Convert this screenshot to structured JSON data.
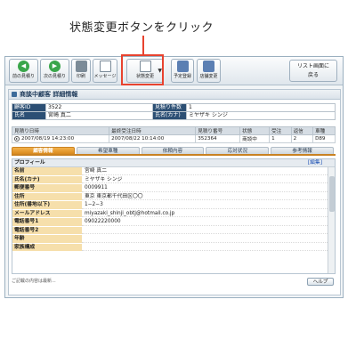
{
  "caption": "状態変更ボタンをクリック",
  "toolbar": {
    "buttons": [
      {
        "label": "前の見積り",
        "icon": "arrow-left-icon"
      },
      {
        "label": "次の見積り",
        "icon": "arrow-right-icon"
      },
      {
        "label": "印刷",
        "icon": "printer-icon"
      },
      {
        "label": "メッセージ",
        "icon": "message-icon"
      },
      {
        "label": "状態変更",
        "icon": "status-change-icon"
      },
      {
        "label": "予定登録",
        "icon": "schedule-icon"
      },
      {
        "label": "店舗変更",
        "icon": "store-icon"
      }
    ],
    "back_label_1": "リスト画面に",
    "back_label_2": "戻る"
  },
  "panel": {
    "title": "商談中顧客 詳細情報"
  },
  "header": {
    "customer_id_label": "顧客ID",
    "customer_id": "3522",
    "name_label": "氏名",
    "name": "宮崎 真二",
    "quote_count_label": "見積り件数",
    "quote_count": "1",
    "kana_label": "氏名(カナ)",
    "kana": "ミヤザキ シンジ"
  },
  "quotes": {
    "columns": [
      "見積り日時",
      "最終受注日時",
      "見積り番号",
      "状態",
      "受注",
      "返信",
      "車種"
    ],
    "rows": [
      {
        "date": "2007/08/19 14:23:00",
        "last": "2007/08/22 10:14:00",
        "number": "352364",
        "status": "商談中",
        "order": "1",
        "reply": "2",
        "car": "D89"
      }
    ]
  },
  "tabs": [
    "顧客情報",
    "希望車種",
    "依頼内容",
    "応対状況",
    "参考情報"
  ],
  "profile": {
    "heading": "プロフィール",
    "edit_label": "[編集]",
    "fields": [
      {
        "label": "名前",
        "value": "宮崎 真二"
      },
      {
        "label": "氏名(カナ)",
        "value": "ミヤザキ シンジ"
      },
      {
        "label": "郵便番号",
        "value": "0009911"
      },
      {
        "label": "住所",
        "value": "東京 東京都千代田区〇〇"
      },
      {
        "label": "住所(番地以下)",
        "value": "1−2−3"
      },
      {
        "label": "メールアドレス",
        "value": "miyazaki_shinji_obtj@hotmail.co.jp"
      },
      {
        "label": "電話番号1",
        "value": "09022220000"
      },
      {
        "label": "電話番号2",
        "value": ""
      },
      {
        "label": "年齢",
        "value": ""
      },
      {
        "label": "家族構成",
        "value": ""
      }
    ]
  },
  "footer": {
    "note": "ご記載の内容は最新...",
    "help_label": "ヘルプ"
  }
}
